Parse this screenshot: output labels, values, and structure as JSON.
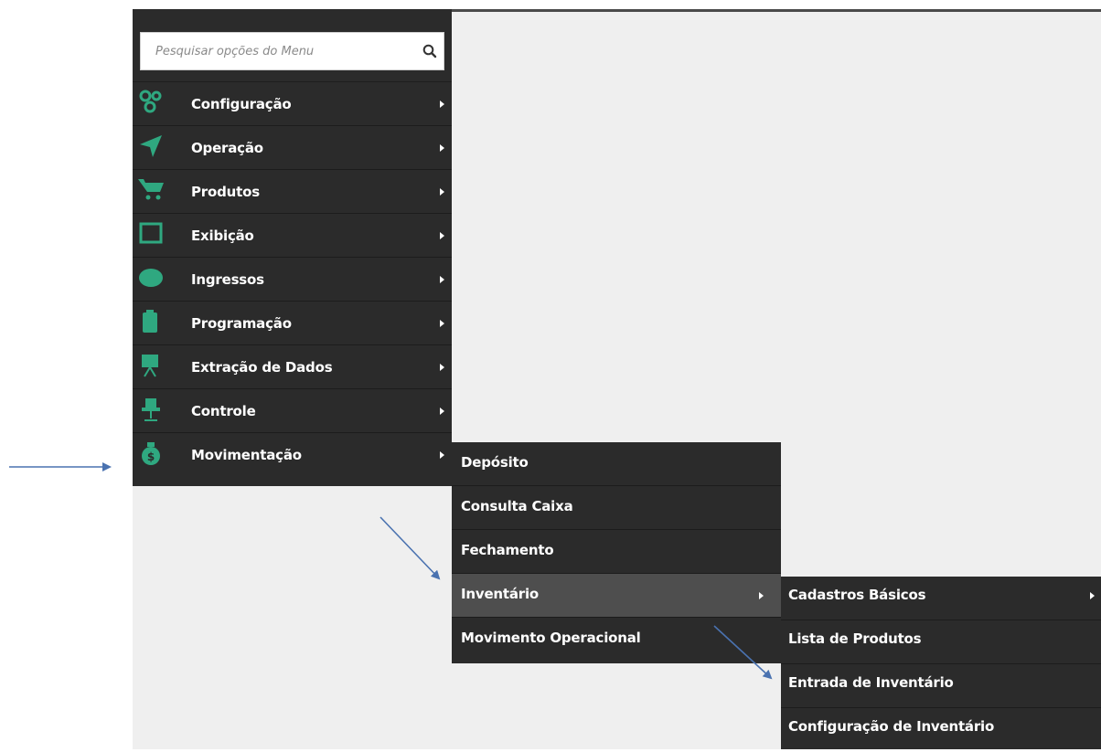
{
  "search": {
    "placeholder": "Pesquisar opções do Menu"
  },
  "main_menu": [
    {
      "label": "Configuração",
      "icon": "gears-icon"
    },
    {
      "label": "Operação",
      "icon": "location-arrow-icon"
    },
    {
      "label": "Produtos",
      "icon": "shopping-cart-icon"
    },
    {
      "label": "Exibição",
      "icon": "screen-icon"
    },
    {
      "label": "Ingressos",
      "icon": "ticket-icon"
    },
    {
      "label": "Programação",
      "icon": "clipboard-icon"
    },
    {
      "label": "Extração de Dados",
      "icon": "presentation-icon"
    },
    {
      "label": "Controle",
      "icon": "chair-icon"
    },
    {
      "label": "Movimentação",
      "icon": "money-bag-icon"
    }
  ],
  "submenu_movimentacao": [
    {
      "label": "Depósito"
    },
    {
      "label": "Consulta Caixa"
    },
    {
      "label": "Fechamento"
    },
    {
      "label": "Inventário",
      "active": true
    },
    {
      "label": "Movimento Operacional"
    }
  ],
  "submenu_inventario": [
    {
      "label": "Cadastros Básicos"
    },
    {
      "label": "Lista de Produtos"
    },
    {
      "label": "Entrada de Inventário"
    },
    {
      "label": "Configuração de Inventário"
    }
  ],
  "colors": {
    "menu_bg": "#2b2b2b",
    "icon_green": "#2fa880",
    "active_bg": "#4e4e4e",
    "annotation_arrow": "#4a72b0"
  }
}
